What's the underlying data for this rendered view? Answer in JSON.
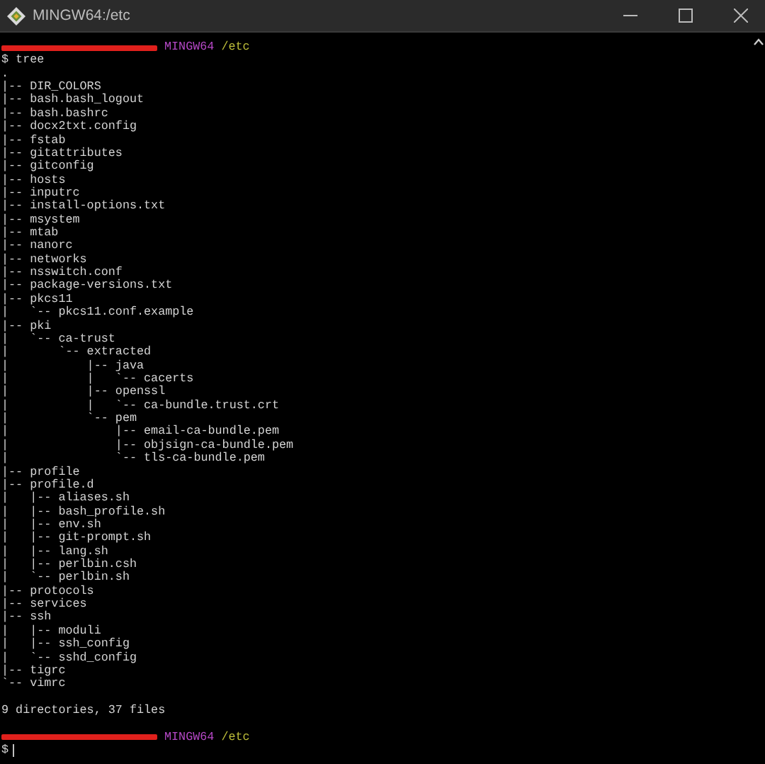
{
  "window": {
    "title": "MINGW64:/etc"
  },
  "lines": [
    {
      "kind": "prompt",
      "host": "MINGW64",
      "path": "/etc"
    },
    {
      "kind": "text",
      "text": "$ tree"
    },
    {
      "kind": "text",
      "text": "."
    },
    {
      "kind": "text",
      "text": "|-- DIR_COLORS"
    },
    {
      "kind": "text",
      "text": "|-- bash.bash_logout"
    },
    {
      "kind": "text",
      "text": "|-- bash.bashrc"
    },
    {
      "kind": "text",
      "text": "|-- docx2txt.config"
    },
    {
      "kind": "text",
      "text": "|-- fstab"
    },
    {
      "kind": "text",
      "text": "|-- gitattributes"
    },
    {
      "kind": "text",
      "text": "|-- gitconfig"
    },
    {
      "kind": "text",
      "text": "|-- hosts"
    },
    {
      "kind": "text",
      "text": "|-- inputrc"
    },
    {
      "kind": "text",
      "text": "|-- install-options.txt"
    },
    {
      "kind": "text",
      "text": "|-- msystem"
    },
    {
      "kind": "text",
      "text": "|-- mtab"
    },
    {
      "kind": "text",
      "text": "|-- nanorc"
    },
    {
      "kind": "text",
      "text": "|-- networks"
    },
    {
      "kind": "text",
      "text": "|-- nsswitch.conf"
    },
    {
      "kind": "text",
      "text": "|-- package-versions.txt"
    },
    {
      "kind": "text",
      "text": "|-- pkcs11"
    },
    {
      "kind": "text",
      "text": "|   `-- pkcs11.conf.example"
    },
    {
      "kind": "text",
      "text": "|-- pki"
    },
    {
      "kind": "text",
      "text": "|   `-- ca-trust"
    },
    {
      "kind": "text",
      "text": "|       `-- extracted"
    },
    {
      "kind": "text",
      "text": "|           |-- java"
    },
    {
      "kind": "text",
      "text": "|           |   `-- cacerts"
    },
    {
      "kind": "text",
      "text": "|           |-- openssl"
    },
    {
      "kind": "text",
      "text": "|           |   `-- ca-bundle.trust.crt"
    },
    {
      "kind": "text",
      "text": "|           `-- pem"
    },
    {
      "kind": "text",
      "text": "|               |-- email-ca-bundle.pem"
    },
    {
      "kind": "text",
      "text": "|               |-- objsign-ca-bundle.pem"
    },
    {
      "kind": "text",
      "text": "|               `-- tls-ca-bundle.pem"
    },
    {
      "kind": "text",
      "text": "|-- profile"
    },
    {
      "kind": "text",
      "text": "|-- profile.d"
    },
    {
      "kind": "text",
      "text": "|   |-- aliases.sh"
    },
    {
      "kind": "text",
      "text": "|   |-- bash_profile.sh"
    },
    {
      "kind": "text",
      "text": "|   |-- env.sh"
    },
    {
      "kind": "text",
      "text": "|   |-- git-prompt.sh"
    },
    {
      "kind": "text",
      "text": "|   |-- lang.sh"
    },
    {
      "kind": "text",
      "text": "|   |-- perlbin.csh"
    },
    {
      "kind": "text",
      "text": "|   `-- perlbin.sh"
    },
    {
      "kind": "text",
      "text": "|-- protocols"
    },
    {
      "kind": "text",
      "text": "|-- services"
    },
    {
      "kind": "text",
      "text": "|-- ssh"
    },
    {
      "kind": "text",
      "text": "|   |-- moduli"
    },
    {
      "kind": "text",
      "text": "|   |-- ssh_config"
    },
    {
      "kind": "text",
      "text": "|   `-- sshd_config"
    },
    {
      "kind": "text",
      "text": "|-- tigrc"
    },
    {
      "kind": "text",
      "text": "`-- vimrc"
    },
    {
      "kind": "blank"
    },
    {
      "kind": "text",
      "text": "9 directories, 37 files"
    },
    {
      "kind": "blank"
    },
    {
      "kind": "prompt",
      "host": "MINGW64",
      "path": "/etc"
    },
    {
      "kind": "input",
      "text": "$"
    }
  ]
}
